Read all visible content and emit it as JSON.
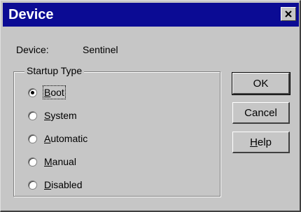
{
  "window": {
    "title": "Device",
    "titlebar_color": "#0b0b94"
  },
  "device": {
    "label": "Device:",
    "value": "Sentinel"
  },
  "startup": {
    "group_title": "Startup Type",
    "options": [
      {
        "label": "Boot",
        "mnemonic": "B",
        "rest": "oot",
        "selected": true
      },
      {
        "label": "System",
        "mnemonic": "S",
        "rest": "ystem",
        "selected": false
      },
      {
        "label": "Automatic",
        "mnemonic": "A",
        "rest": "utomatic",
        "selected": false
      },
      {
        "label": "Manual",
        "mnemonic": "M",
        "rest": "anual",
        "selected": false
      },
      {
        "label": "Disabled",
        "mnemonic": "D",
        "rest": "isabled",
        "selected": false
      }
    ]
  },
  "buttons": {
    "ok": "OK",
    "cancel": "Cancel",
    "help_mnemonic": "H",
    "help_rest": "elp"
  }
}
